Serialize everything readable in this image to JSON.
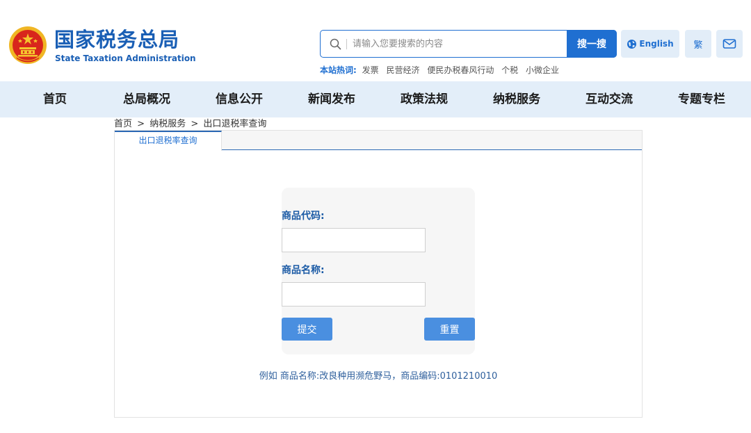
{
  "header": {
    "logo_cn": "国家税务总局",
    "logo_en": "State Taxation Administration",
    "search_placeholder": "请输入您要搜索的内容",
    "search_button": "搜一搜",
    "english_label": "English",
    "traditional_label": "繁",
    "hot_label": "本站热词:",
    "hot_words": [
      "发票",
      "民营经济",
      "便民办税春风行动",
      "个税",
      "小微企业"
    ]
  },
  "nav": {
    "items": [
      "首页",
      "总局概况",
      "信息公开",
      "新闻发布",
      "政策法规",
      "纳税服务",
      "互动交流",
      "专题专栏"
    ]
  },
  "breadcrumb": {
    "items": [
      "首页",
      "纳税服务",
      "出口退税率查询"
    ],
    "separator": ">"
  },
  "panel": {
    "tab_label": "出口退税率查询"
  },
  "form": {
    "code_label": "商品代码:",
    "code_value": "",
    "name_label": "商品名称:",
    "name_value": "",
    "submit_label": "提交",
    "reset_label": "重置",
    "example": "例如 商品名称:改良种用濒危野马，商品编码:0101210010"
  },
  "colors": {
    "brand_blue": "#1a5fb5",
    "nav_bg": "#e3eef9",
    "button_blue": "#4a8fe0"
  }
}
